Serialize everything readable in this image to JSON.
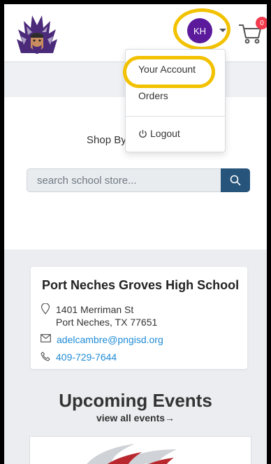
{
  "header": {
    "avatar_initials": "KH",
    "cart_count": "0",
    "logo_icon": "indian-chief-logo",
    "cart_icon": "shopping-cart-icon",
    "accent_color": "#5b1a9c",
    "highlight_color": "#f2c200"
  },
  "account_menu": {
    "items": [
      {
        "label": "Your Account"
      },
      {
        "label": "Orders"
      },
      {
        "label": "Logout",
        "icon": "power-icon"
      }
    ]
  },
  "shop": {
    "heading_partial": "Shop By"
  },
  "search": {
    "placeholder": "search school store...",
    "button_icon": "search-icon",
    "button_color": "#27547a"
  },
  "school": {
    "name": "Port Neches Groves High School",
    "address_line1": "1401 Merriman St",
    "address_line2": "Port Neches, TX 77651",
    "email": "adelcambre@pngisd.org",
    "phone": "409-729-7644"
  },
  "events": {
    "title": "Upcoming Events",
    "link": "view all events→"
  }
}
